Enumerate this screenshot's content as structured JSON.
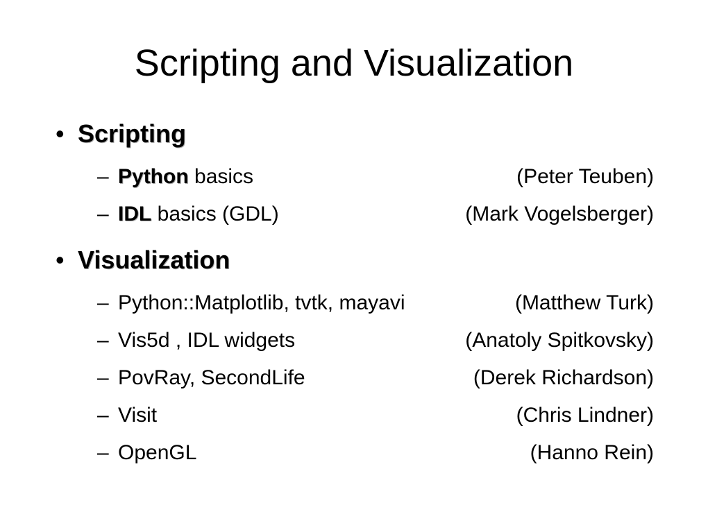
{
  "title": "Scripting and Visualization",
  "sections": [
    {
      "heading": "Scripting",
      "items": [
        {
          "left_bold": "Python",
          "left_rest": " basics",
          "right": "(Peter Teuben)"
        },
        {
          "left_bold": "IDL",
          "left_rest": " basics (GDL)",
          "right": "(Mark Vogelsberger)"
        }
      ]
    },
    {
      "heading": "Visualization",
      "items": [
        {
          "left_bold": "",
          "left_rest": "Python::Matplotlib, tvtk, mayavi",
          "right": "(Matthew Turk)"
        },
        {
          "left_bold": "",
          "left_rest": "Vis5d , IDL widgets",
          "right": "(Anatoly Spitkovsky)"
        },
        {
          "left_bold": "",
          "left_rest": "PovRay, SecondLife",
          "right": "(Derek Richardson)"
        },
        {
          "left_bold": "",
          "left_rest": "Visit",
          "right": "(Chris Lindner)"
        },
        {
          "left_bold": "",
          "left_rest": "OpenGL",
          "right": "(Hanno Rein)"
        }
      ]
    }
  ]
}
